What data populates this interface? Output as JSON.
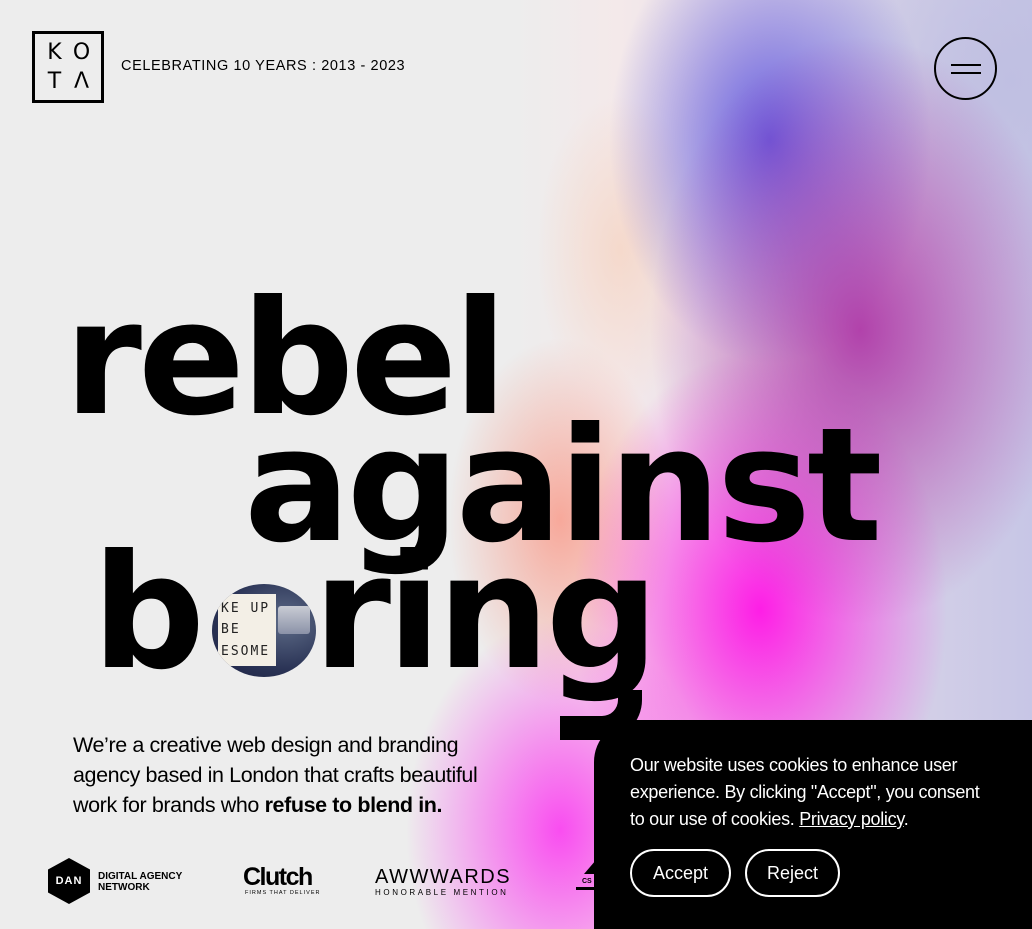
{
  "header": {
    "logo_letters": [
      "K",
      "O",
      "T",
      "Λ"
    ],
    "tagline": "CELEBRATING 10 YEARS : 2013 - 2023"
  },
  "hero": {
    "line1": "rebel",
    "line2": "against",
    "line3_b": "b",
    "line3_rest": "ring",
    "photo_board_lines": [
      "KE UP",
      "BE",
      "ESOME"
    ]
  },
  "intro": {
    "text": "We’re a creative web design and branding agency based in London that crafts beautiful work for brands who ",
    "emphasis": "refuse to blend in."
  },
  "awards": {
    "dan_badge": "DAN",
    "dan_line1": "DIGITAL AGENCY",
    "dan_line2": "NETWORK",
    "clutch_name": "Clutch",
    "clutch_tagline": "FIRMS THAT DELIVER",
    "awwwards_name": "AWWWARDS",
    "awwwards_sub": "HONORABLE MENTION",
    "partial_text": "CS"
  },
  "cookie": {
    "message": "Our website uses cookies to enhance user experience. By clicking \"Accept\", you consent to our use of cookies. ",
    "link_label": "Privacy policy",
    "link_suffix": ".",
    "accept_label": "Accept",
    "reject_label": "Reject"
  },
  "colors": {
    "black": "#000000",
    "background": "#ececec",
    "magenta": "#ff14e6",
    "purple": "#aa28a0",
    "blue": "#5046dc"
  }
}
